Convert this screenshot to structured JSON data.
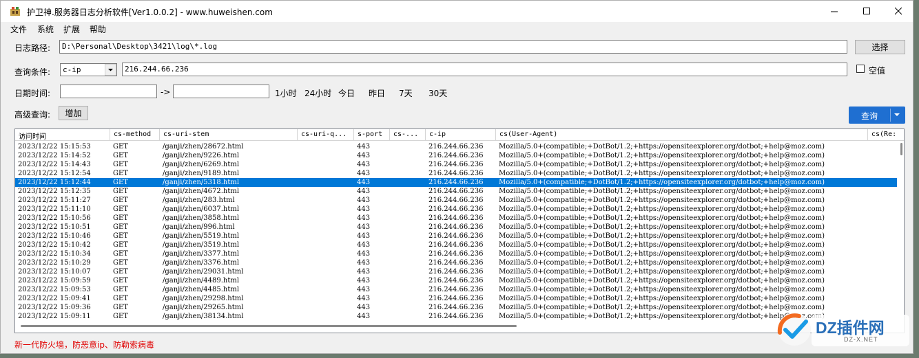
{
  "window": {
    "title": "护卫神.服务器日志分析软件[Ver1.0.0.2] - www.huweishen.com"
  },
  "menu": [
    "文件",
    "系统",
    "扩展",
    "帮助"
  ],
  "form": {
    "log_path_label": "日志路径:",
    "log_path_value": "D:\\Personal\\Desktop\\3421\\log\\*.log",
    "choose_button": "选择",
    "query_label": "查询条件:",
    "query_field": "c-ip",
    "query_value": "216.244.66.236",
    "empty_checkbox_label": "空值",
    "empty_checked": false,
    "date_label": "日期时间:",
    "date_from": "",
    "date_arrow": "->",
    "date_to": "",
    "quick_ranges": [
      "1小时",
      "24小时",
      "今日",
      "昨日",
      "7天",
      "30天"
    ],
    "advanced_label": "高级查询:",
    "add_button": "增加",
    "query_button": "查询"
  },
  "grid": {
    "columns": [
      "访问时间",
      "cs-method",
      "cs-uri-stem",
      "cs-uri-q...",
      "s-port",
      "cs-...",
      "c-ip",
      "cs(User-Agent)",
      "cs(Re:"
    ],
    "selected_index": 4,
    "rows": [
      [
        "2023/12/22 15:15:53",
        "GET",
        "/ganji/zhen/28672.html",
        "",
        "443",
        "",
        "216.244.66.236",
        "Mozilla/5.0+(compatible;+DotBot/1.2;+https://opensiteexplorer.org/dotbot;+help@moz.com)"
      ],
      [
        "2023/12/22 15:14:52",
        "GET",
        "/ganji/zhen/9226.html",
        "",
        "443",
        "",
        "216.244.66.236",
        "Mozilla/5.0+(compatible;+DotBot/1.2;+https://opensiteexplorer.org/dotbot;+help@moz.com)"
      ],
      [
        "2023/12/22 15:14:43",
        "GET",
        "/ganji/zhen/6269.html",
        "",
        "443",
        "",
        "216.244.66.236",
        "Mozilla/5.0+(compatible;+DotBot/1.2;+https://opensiteexplorer.org/dotbot;+help@moz.com)"
      ],
      [
        "2023/12/22 15:12:54",
        "GET",
        "/ganji/zhen/9189.html",
        "",
        "443",
        "",
        "216.244.66.236",
        "Mozilla/5.0+(compatible;+DotBot/1.2;+https://opensiteexplorer.org/dotbot;+help@moz.com)"
      ],
      [
        "2023/12/22 15:12:44",
        "GET",
        "/ganji/zhen/5318.html",
        "",
        "443",
        "",
        "216.244.66.236",
        "Mozilla/5.0+(compatible;+DotBot/1.2;+https://opensiteexplorer.org/dotbot;+help@moz.com)"
      ],
      [
        "2023/12/22 15:12:35",
        "GET",
        "/ganji/zhen/4672.html",
        "",
        "443",
        "",
        "216.244.66.236",
        "Mozilla/5.0+(compatible;+DotBot/1.2;+https://opensiteexplorer.org/dotbot;+help@moz.com)"
      ],
      [
        "2023/12/22 15:11:27",
        "GET",
        "/ganji/zhen/283.html",
        "",
        "443",
        "",
        "216.244.66.236",
        "Mozilla/5.0+(compatible;+DotBot/1.2;+https://opensiteexplorer.org/dotbot;+help@moz.com)"
      ],
      [
        "2023/12/22 15:11:10",
        "GET",
        "/ganji/zhen/6037.html",
        "",
        "443",
        "",
        "216.244.66.236",
        "Mozilla/5.0+(compatible;+DotBot/1.2;+https://opensiteexplorer.org/dotbot;+help@moz.com)"
      ],
      [
        "2023/12/22 15:10:56",
        "GET",
        "/ganji/zhen/3858.html",
        "",
        "443",
        "",
        "216.244.66.236",
        "Mozilla/5.0+(compatible;+DotBot/1.2;+https://opensiteexplorer.org/dotbot;+help@moz.com)"
      ],
      [
        "2023/12/22 15:10:51",
        "GET",
        "/ganji/zhen/996.html",
        "",
        "443",
        "",
        "216.244.66.236",
        "Mozilla/5.0+(compatible;+DotBot/1.2;+https://opensiteexplorer.org/dotbot;+help@moz.com)"
      ],
      [
        "2023/12/22 15:10:46",
        "GET",
        "/ganji/zhen/5519.html",
        "",
        "443",
        "",
        "216.244.66.236",
        "Mozilla/5.0+(compatible;+DotBot/1.2;+https://opensiteexplorer.org/dotbot;+help@moz.com)"
      ],
      [
        "2023/12/22 15:10:42",
        "GET",
        "/ganji/zhen/3519.html",
        "",
        "443",
        "",
        "216.244.66.236",
        "Mozilla/5.0+(compatible;+DotBot/1.2;+https://opensiteexplorer.org/dotbot;+help@moz.com)"
      ],
      [
        "2023/12/22 15:10:34",
        "GET",
        "/ganji/zhen/3377.html",
        "",
        "443",
        "",
        "216.244.66.236",
        "Mozilla/5.0+(compatible;+DotBot/1.2;+https://opensiteexplorer.org/dotbot;+help@moz.com)"
      ],
      [
        "2023/12/22 15:10:29",
        "GET",
        "/ganji/zhen/3376.html",
        "",
        "443",
        "",
        "216.244.66.236",
        "Mozilla/5.0+(compatible;+DotBot/1.2;+https://opensiteexplorer.org/dotbot;+help@moz.com)"
      ],
      [
        "2023/12/22 15:10:07",
        "GET",
        "/ganji/zhen/29031.html",
        "",
        "443",
        "",
        "216.244.66.236",
        "Mozilla/5.0+(compatible;+DotBot/1.2;+https://opensiteexplorer.org/dotbot;+help@moz.com)"
      ],
      [
        "2023/12/22 15:09:59",
        "GET",
        "/ganji/zhen/4489.html",
        "",
        "443",
        "",
        "216.244.66.236",
        "Mozilla/5.0+(compatible;+DotBot/1.2;+https://opensiteexplorer.org/dotbot;+help@moz.com)"
      ],
      [
        "2023/12/22 15:09:53",
        "GET",
        "/ganji/zhen/4485.html",
        "",
        "443",
        "",
        "216.244.66.236",
        "Mozilla/5.0+(compatible;+DotBot/1.2;+https://opensiteexplorer.org/dotbot;+help@moz.com)"
      ],
      [
        "2023/12/22 15:09:41",
        "GET",
        "/ganji/zhen/29298.html",
        "",
        "443",
        "",
        "216.244.66.236",
        "Mozilla/5.0+(compatible;+DotBot/1.2;+https://opensiteexplorer.org/dotbot;+help@moz.com)"
      ],
      [
        "2023/12/22 15:09:36",
        "GET",
        "/ganji/zhen/29265.html",
        "",
        "443",
        "",
        "216.244.66.236",
        "Mozilla/5.0+(compatible;+DotBot/1.2;+https://opensiteexplorer.org/dotbot;+help@moz.com)"
      ],
      [
        "2023/12/22 15:09:11",
        "GET",
        "/ganji/zhen/38134.html",
        "",
        "443",
        "",
        "216.244.66.236",
        "Mozilla/5.0+(compatible;+DotBot/1.2;+https://opensiteexplorer.org/dotbot;+help@moz.com)"
      ]
    ]
  },
  "status_text": "新一代防火墙，防恶意ip、防勒索病毒",
  "watermark": {
    "brand": "DZ插件网",
    "url": "DZ-X.NET"
  },
  "colors": {
    "selection": "#0078d7",
    "query_button": "#1f6fd1",
    "status": "#e00000"
  }
}
